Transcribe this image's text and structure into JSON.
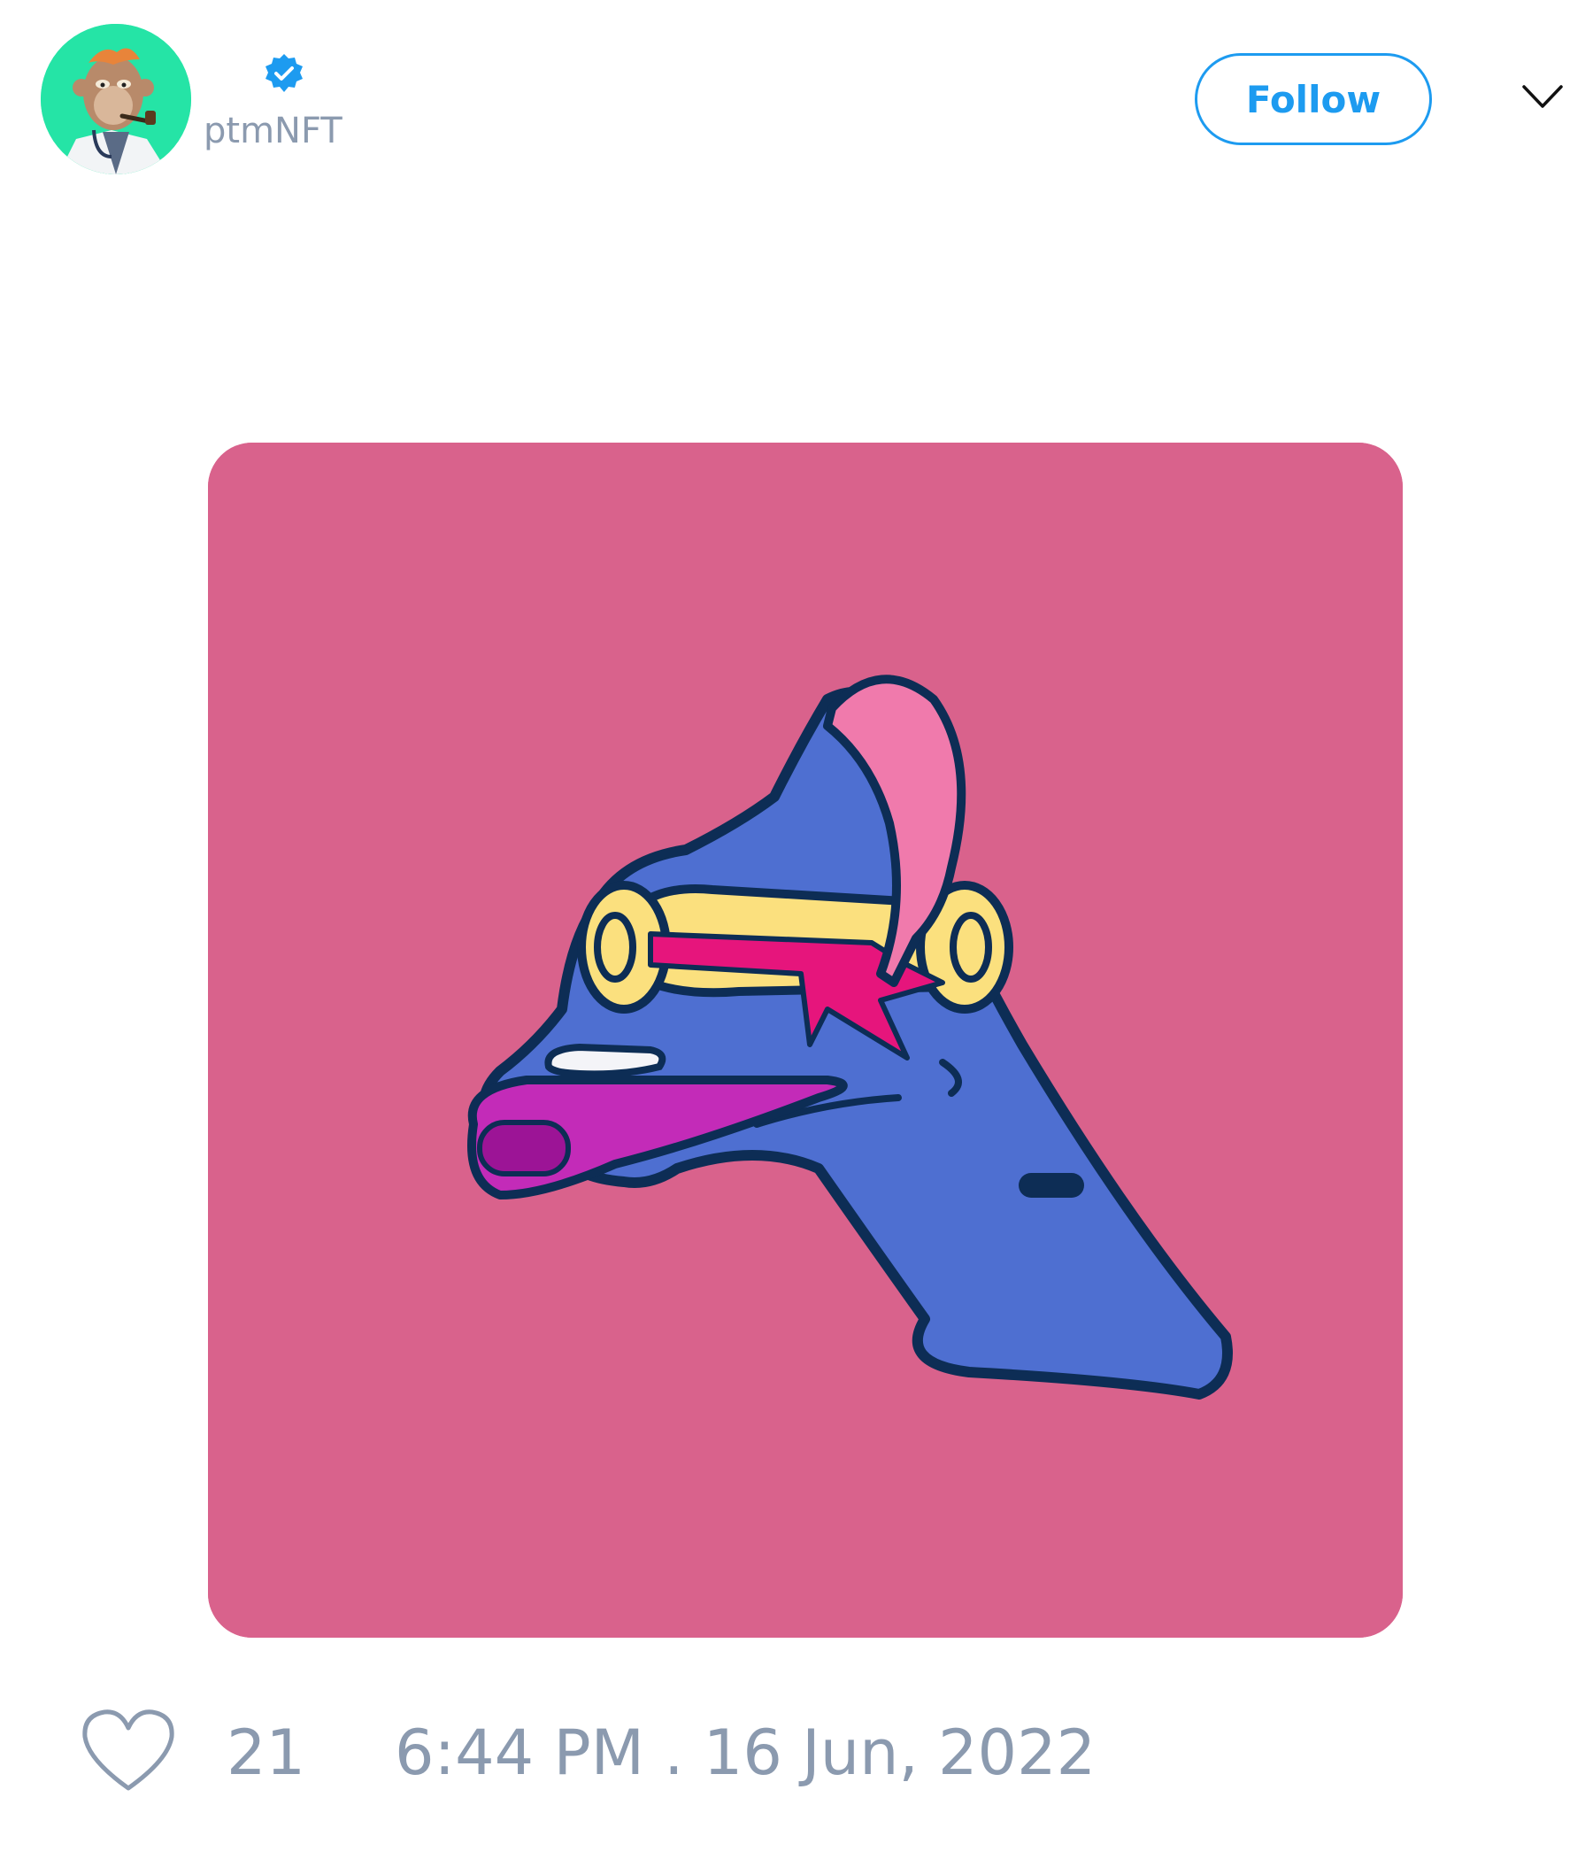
{
  "author": {
    "handle": "ptmNFT",
    "verified": true,
    "avatar_icon": "bored-ape-avatar"
  },
  "header": {
    "follow_label": "Follow",
    "menu_icon": "chevron-down-icon"
  },
  "media": {
    "image": "tweet-media-image"
  },
  "footer": {
    "like_icon": "heart-icon",
    "like_count": "21",
    "timestamp": "6:44 PM . 16 Jun, 2022"
  },
  "colors": {
    "accent": "#1d9bf0",
    "muted_text": "#8b9aaf",
    "avatar_bg": "#25e4a6",
    "media_bg": "#d9628c"
  }
}
